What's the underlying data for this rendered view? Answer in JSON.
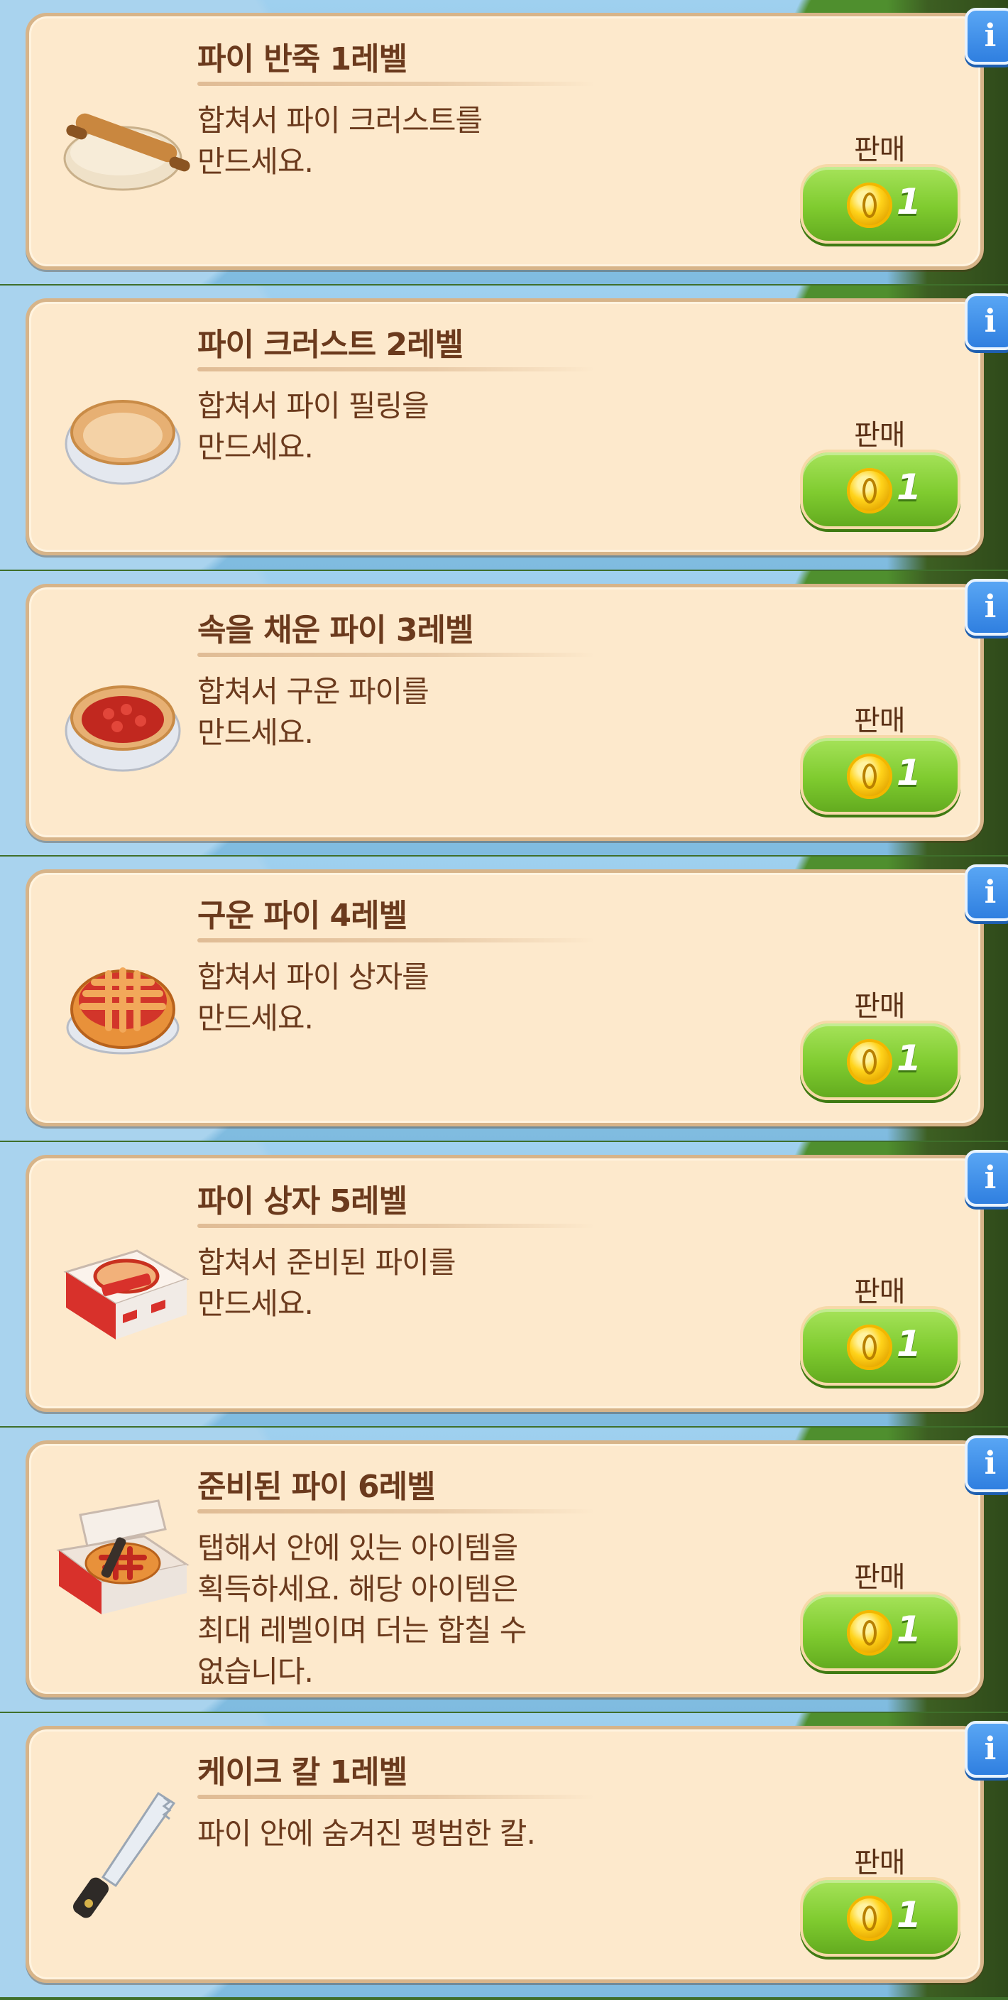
{
  "sell_label": "판매",
  "info_glyph": "i",
  "items": [
    {
      "title": "파이 반죽 1레벨",
      "desc": "합쳐서 파이 크러스트를\n만드세요.",
      "price": "1",
      "icon": "dough-rolling-pin-icon"
    },
    {
      "title": "파이 크러스트 2레벨",
      "desc": "합쳐서 파이 필링을\n만드세요.",
      "price": "1",
      "icon": "pie-crust-icon"
    },
    {
      "title": "속을 채운 파이 3레벨",
      "desc": "합쳐서 구운 파이를\n만드세요.",
      "price": "1",
      "icon": "filled-pie-icon"
    },
    {
      "title": "구운 파이 4레벨",
      "desc": "합쳐서 파이 상자를\n만드세요.",
      "price": "1",
      "icon": "baked-pie-icon"
    },
    {
      "title": "파이 상자 5레벨",
      "desc": "합쳐서 준비된 파이를\n만드세요.",
      "price": "1",
      "icon": "pie-box-icon"
    },
    {
      "title": "준비된 파이 6레벨",
      "desc": "탭해서 안에 있는 아이템을\n획득하세요. 해당 아이템은\n최대 레벨이며 더는 합칠 수\n없습니다.",
      "price": "1",
      "icon": "ready-pie-icon"
    },
    {
      "title": "케이크 칼 1레벨",
      "desc": "파이 안에 숨겨진 평범한 칼.",
      "price": "1",
      "icon": "cake-knife-icon"
    }
  ]
}
